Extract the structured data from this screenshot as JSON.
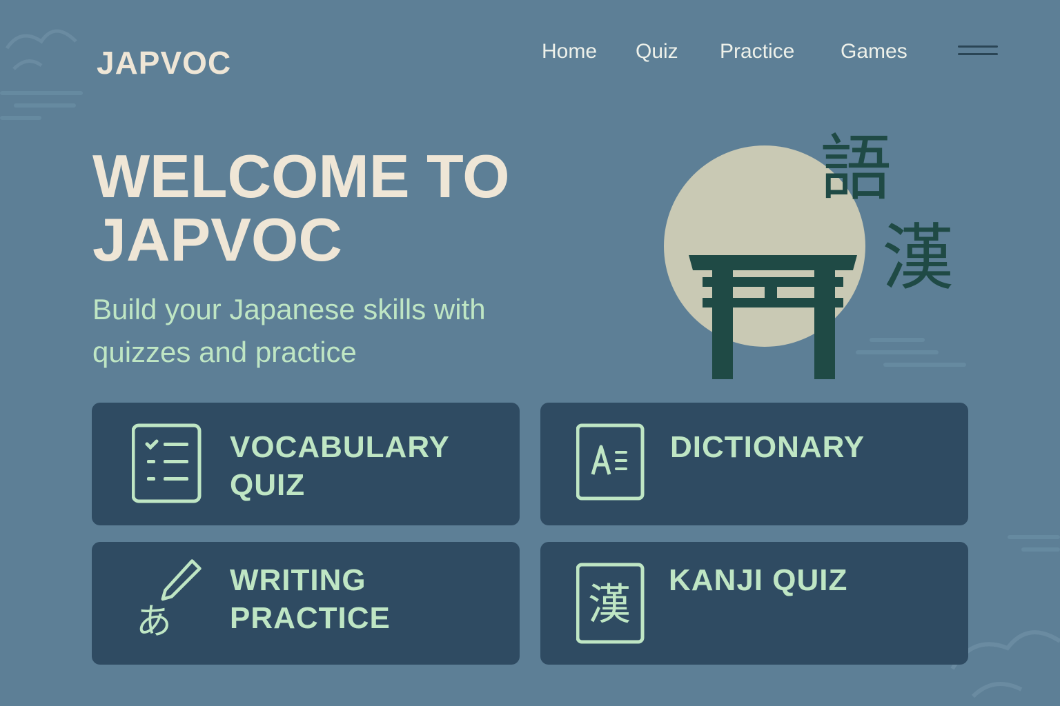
{
  "header": {
    "logo": "JAPVOC",
    "nav": [
      {
        "label": "Home"
      },
      {
        "label": "Quiz"
      },
      {
        "label": "Practice"
      },
      {
        "label": "Games"
      }
    ],
    "menu_icon": "hamburger-icon"
  },
  "hero": {
    "title_line1": "WELCOME TO",
    "title_line2": "JAPVOC",
    "subtitle_line1": "Build your Japanese skills with",
    "subtitle_line2": "quizzes and practice",
    "kanji_top": "語",
    "kanji_bottom": "漢",
    "illustration_icon": "torii-gate-icon"
  },
  "cards": [
    {
      "line1": "VOCABULARY",
      "line2": "QUIZ",
      "icon": "checklist-icon"
    },
    {
      "line1": "DICTIONARY",
      "line2": "",
      "icon": "dictionary-icon"
    },
    {
      "line1": "WRITING",
      "line2": "PRACTICE",
      "icon": "brush-hiragana-icon",
      "icon_char": "あ"
    },
    {
      "line1": "KANJI QUIZ",
      "line2": "",
      "icon": "kanji-icon",
      "icon_char": "漢"
    }
  ],
  "colors": {
    "background": "#5d7f96",
    "card": "#2f4b62",
    "accent_green": "#bfe6c4",
    "title_cream": "#efe6d6",
    "moon": "#c9c9b4",
    "torii": "#1f4a45"
  }
}
